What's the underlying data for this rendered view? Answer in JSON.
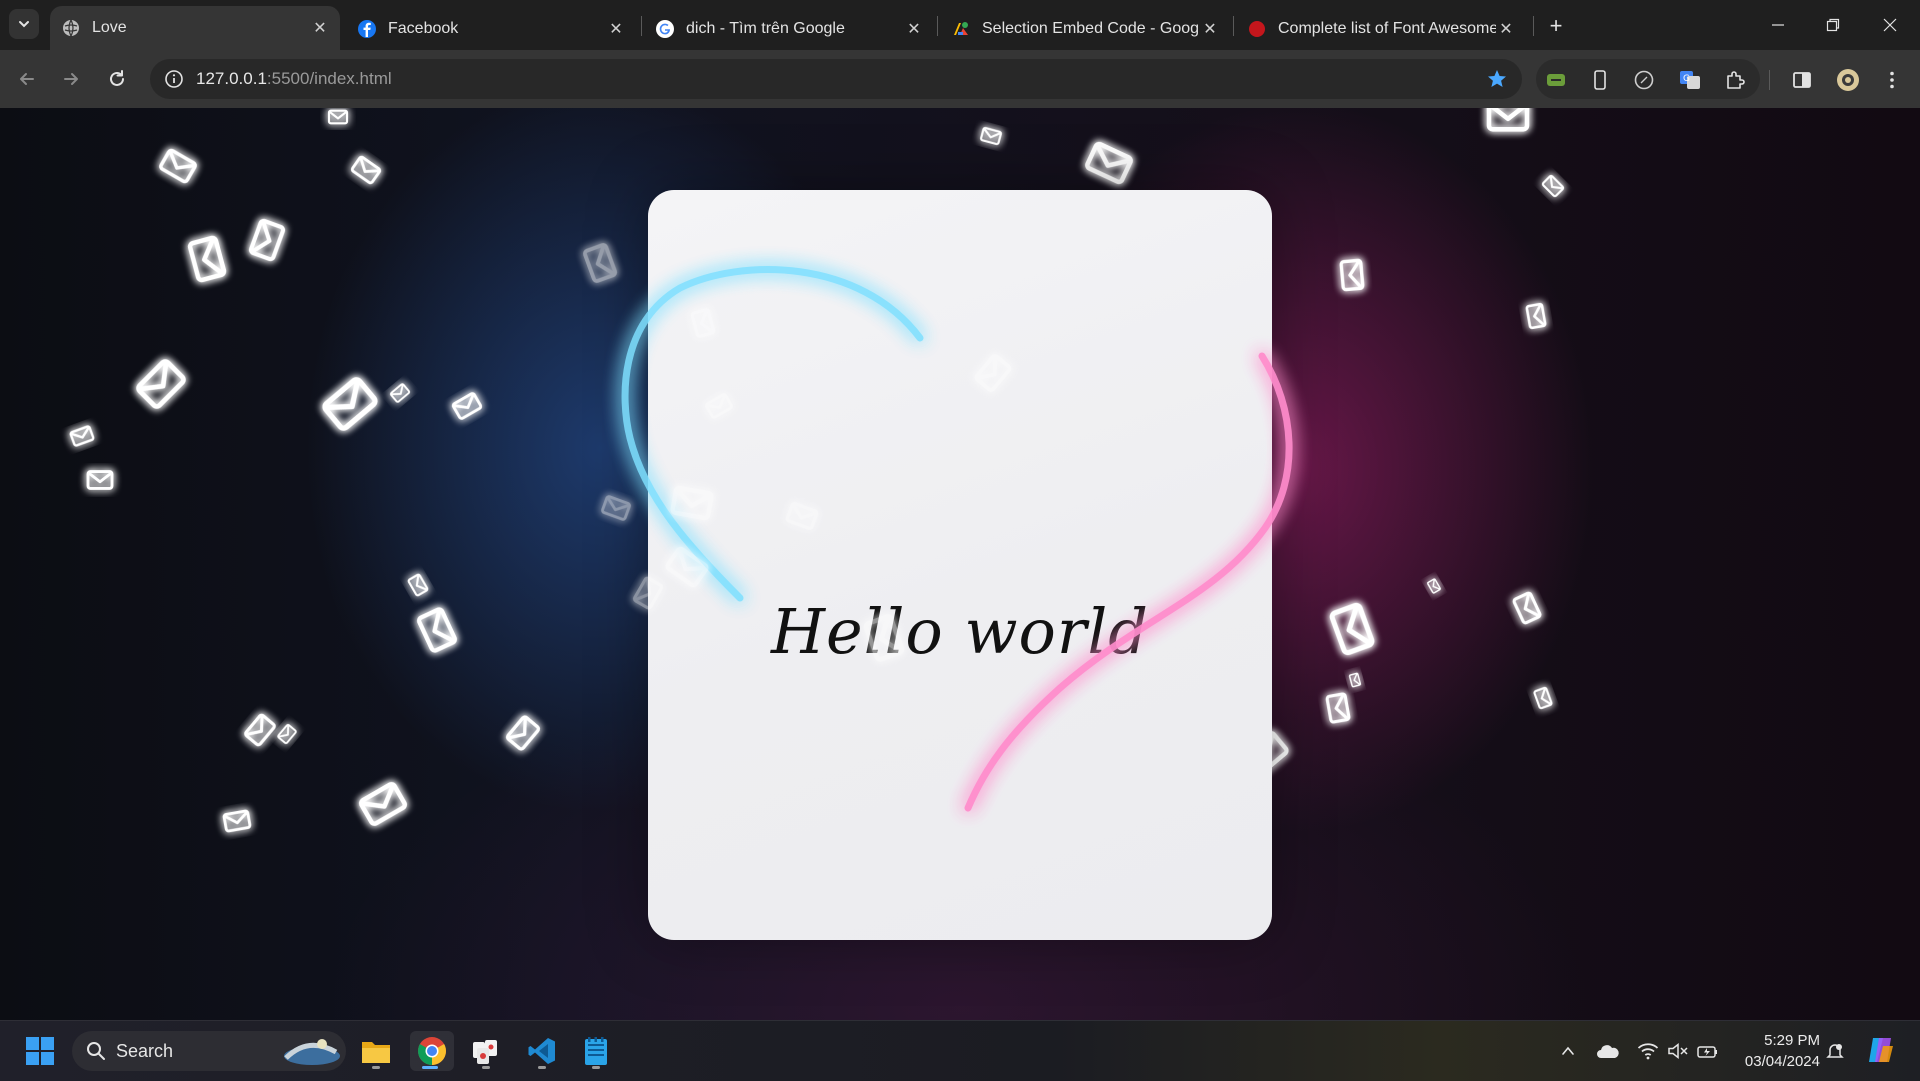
{
  "browser": {
    "tabs": [
      {
        "title": "Love",
        "favicon": "globe-icon",
        "active": true
      },
      {
        "title": "Facebook",
        "favicon": "facebook-icon",
        "active": false
      },
      {
        "title": "dich - Tìm trên Google",
        "favicon": "google-icon",
        "active": false
      },
      {
        "title": "Selection Embed Code - Google",
        "favicon": "google-fonts-icon",
        "active": false
      },
      {
        "title": "Complete list of Font Awesome",
        "favicon": "red-circle-icon",
        "active": false
      }
    ],
    "new_tab_label": "+",
    "address": {
      "host": "127.0.0.1",
      "rest": ":5500/index.html"
    }
  },
  "page": {
    "card_text": "Hello world",
    "colors": {
      "neon_left": "#6fd6ff",
      "neon_right": "#ff4fa8",
      "card": "#f0f0f2"
    }
  },
  "taskbar": {
    "search_label": "Search",
    "pinned": [
      "start-icon",
      "file-explorer-icon",
      "chrome-icon",
      "mahjong-icon",
      "vscode-icon",
      "notepad-icon"
    ],
    "time": "5:29 PM",
    "date": "03/04/2024"
  }
}
